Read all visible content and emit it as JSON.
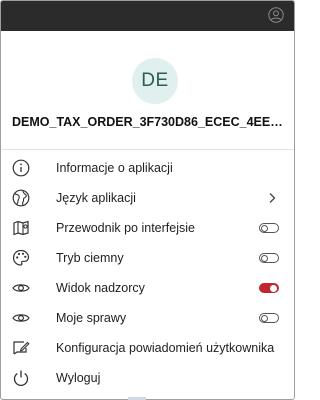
{
  "profile": {
    "initials": "DE",
    "user_name": "DEMO_TAX_ORDER_3F730D86_ECEC_4EE9_A..."
  },
  "menu": {
    "items": [
      {
        "label": "Informacje o aplikacji",
        "icon": "info-icon"
      },
      {
        "label": "Język aplikacji",
        "icon": "globe-icon",
        "has_submenu": true
      },
      {
        "label": "Przewodnik po interfejsie",
        "icon": "map-guide-icon",
        "toggle": false
      },
      {
        "label": "Tryb ciemny",
        "icon": "palette-icon",
        "toggle": false
      },
      {
        "label": "Widok nadzorcy",
        "icon": "eye-icon",
        "toggle": true
      },
      {
        "label": "Moje sprawy",
        "icon": "eye-icon",
        "toggle": false
      },
      {
        "label": "Konfiguracja powiadomień użytkownika",
        "icon": "edit-notification-icon"
      },
      {
        "label": "Wyloguj",
        "icon": "power-icon"
      }
    ]
  },
  "colors": {
    "topbar": "#2b2b2b",
    "avatar_bg": "#dff0ef",
    "avatar_text": "#2e5b57",
    "toggle_on": "#c0262c"
  }
}
